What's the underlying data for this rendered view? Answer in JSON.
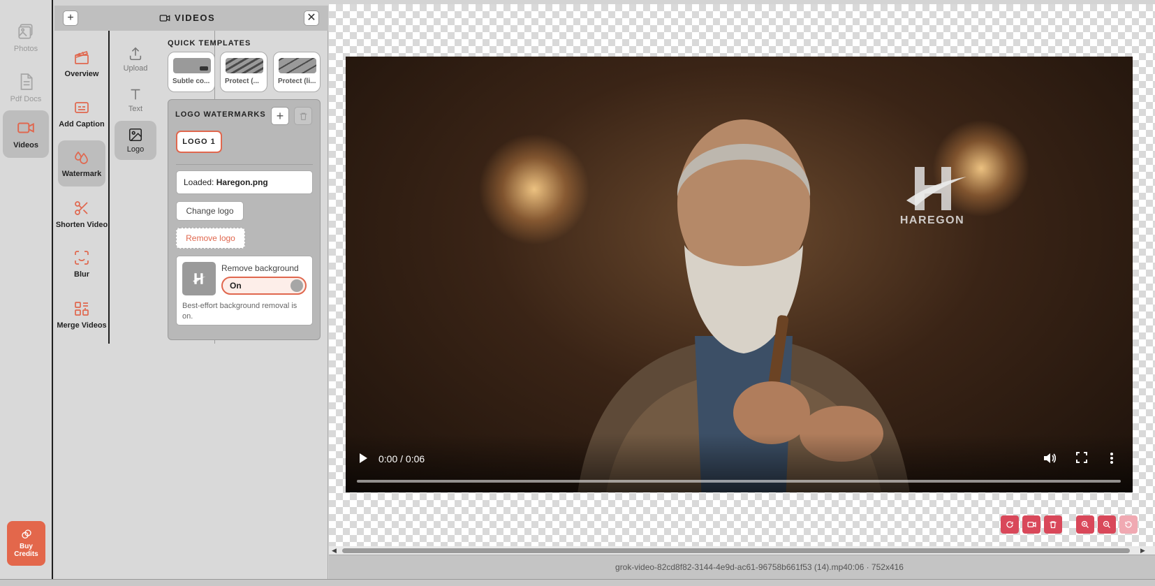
{
  "rail": {
    "items": [
      {
        "label": "Photos",
        "icon": "photos-icon"
      },
      {
        "label": "Pdf Docs",
        "icon": "pdf-icon"
      },
      {
        "label": "Videos",
        "icon": "video-icon"
      }
    ],
    "buy_label": "Buy Credits"
  },
  "panel": {
    "title": "VIDEOS",
    "features": [
      {
        "label": "Overview"
      },
      {
        "label": "Add Caption"
      },
      {
        "label": "Watermark"
      },
      {
        "label": "Shorten Video"
      },
      {
        "label": "Blur"
      },
      {
        "label": "Merge Videos"
      }
    ],
    "sub": [
      {
        "label": "Upload"
      },
      {
        "label": "Text"
      },
      {
        "label": "Logo"
      }
    ],
    "quick_templates": {
      "title": "QUICK TEMPLATES",
      "items": [
        {
          "label": "Subtle co..."
        },
        {
          "label": "Protect (..."
        },
        {
          "label": "Protect (li..."
        }
      ]
    },
    "logo_watermarks": {
      "title": "LOGO WATERMARKS",
      "add_label": "+",
      "chip_label": "LOGO 1",
      "loaded_prefix": "Loaded:",
      "loaded_file": "Haregon.png",
      "change_label": "Change logo",
      "remove_label": "Remove logo",
      "remove_bg_label": "Remove background",
      "toggle_label": "On",
      "note": "Best-effort background removal is on."
    }
  },
  "canvas": {
    "watermark_text": "HAREGON",
    "time": "0:00 / 0:06",
    "progress_fraction": 0.0,
    "accent": "#e0674e",
    "tool_color": "#d9485a"
  },
  "status": {
    "file_info": "grok-video-82cd8f82-3144-4e9d-ac61-96758b661f53 (14).mp40:06 · 752x416"
  }
}
